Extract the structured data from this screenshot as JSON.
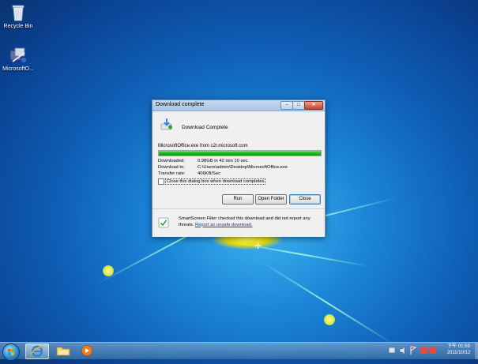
{
  "desktop": {
    "icons": [
      {
        "label": "Recycle Bin"
      },
      {
        "label": "MicrosoftO..."
      }
    ]
  },
  "dialog": {
    "title": "Download complete",
    "heading": "Download Complete",
    "filename_line": "MicrosoftOffice.exe from c2r.microsoft.com",
    "progress_percent": 100,
    "rows": [
      {
        "label": "Downloaded:",
        "value": "0.98GB in 42 min 10 sec"
      },
      {
        "label": "Download to:",
        "value": "C:\\Users\\admin\\Desktop\\MicrosoftOffice.exe"
      },
      {
        "label": "Transfer rate:",
        "value": "406KB/Sec"
      }
    ],
    "checkbox_label": "Close this dialog box when download completes",
    "checkbox_checked": false,
    "buttons": {
      "run": "Run",
      "open_folder": "Open Folder",
      "close": "Close"
    },
    "smartscreen_text": "SmartScreen Filter checked this download and did not report any threats.",
    "smartscreen_link": "Report an unsafe download."
  },
  "taskbar": {
    "clock_time": "下午 01:59",
    "clock_date": "2011/10/12"
  },
  "colors": {
    "progress": "#20b020",
    "link": "#0645ad"
  }
}
